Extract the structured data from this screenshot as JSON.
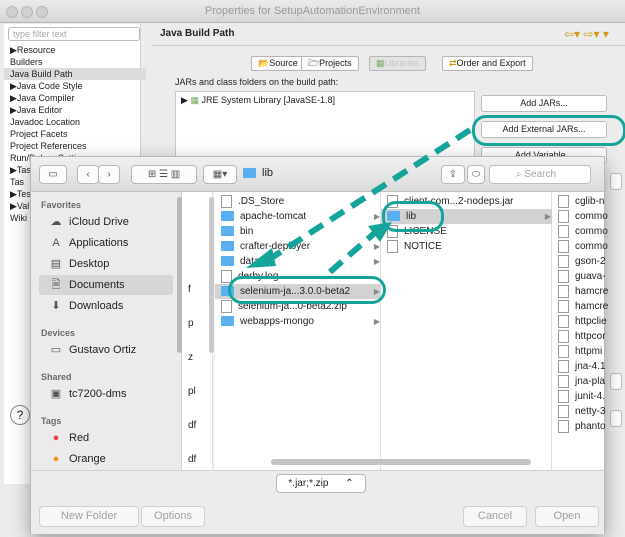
{
  "window": {
    "title": "Properties for SetupAutomationEnvironment"
  },
  "left": {
    "filter_placeholder": "type filter text",
    "tree": [
      {
        "label": "▶Resource"
      },
      {
        "label": "Builders"
      },
      {
        "label": "Java Build Path",
        "selected": true
      },
      {
        "label": "▶Java Code Style"
      },
      {
        "label": "▶Java Compiler"
      },
      {
        "label": "▶Java Editor"
      },
      {
        "label": "Javadoc Location"
      },
      {
        "label": "Project Facets"
      },
      {
        "label": "Project References"
      },
      {
        "label": "Run/Debug Settings"
      },
      {
        "label": "▶Tas"
      },
      {
        "label": "Tas"
      },
      {
        "label": "▶Tes"
      },
      {
        "label": "▶Val"
      },
      {
        "label": "Wiki"
      }
    ]
  },
  "build_path": {
    "title": "Java Build Path",
    "tabs": [
      "Source",
      "Projects",
      "Libraries",
      "Order and Export"
    ],
    "jars_label": "JARs and class folders on the build path:",
    "jre_entry": "JRE System Library [JavaSE-1.8]",
    "buttons": [
      "Add JARs...",
      "Add External JARs...",
      "Add Variable..."
    ]
  },
  "dialog": {
    "path": "lib",
    "search_placeholder": "Search",
    "sidebar": {
      "favorites_header": "Favorites",
      "favorites": [
        "iCloud Drive",
        "Applications",
        "Desktop",
        "Documents",
        "Downloads"
      ],
      "devices_header": "Devices",
      "devices": [
        "Gustavo Ortiz"
      ],
      "shared_header": "Shared",
      "shared": [
        "tc7200-dms"
      ],
      "tags_header": "Tags",
      "tags": [
        {
          "label": "Red",
          "color": "#e5483f"
        },
        {
          "label": "Orange",
          "color": "#f39a2b"
        }
      ]
    },
    "col1_edge": [
      "f",
      "p",
      "z",
      "pl",
      "df",
      "df"
    ],
    "col2": [
      ".DS_Store",
      "apache-tomcat",
      "bin",
      "crafter-deployer",
      "data",
      "derby.log",
      "selenium-ja...3.0.0-beta2",
      "selenium-ja...0-beta2.zip",
      "webapps-mongo"
    ],
    "col3": [
      "client-com...2-nodeps.jar",
      "lib",
      "LICENSE",
      "NOTICE"
    ],
    "col4": [
      "cglib-n",
      "commo",
      "commo",
      "commo",
      "gson-2",
      "guava-",
      "hamcre",
      "hamcre",
      "httpclie",
      "httpcor",
      "httpmi",
      "jna-4.1",
      "jna-pla",
      "junit-4.",
      "netty-3",
      "phanto"
    ],
    "format": "*.jar;*.zip",
    "footer": [
      "New Folder",
      "Options",
      "Cancel",
      "Open"
    ]
  },
  "accent": "#14a49a"
}
